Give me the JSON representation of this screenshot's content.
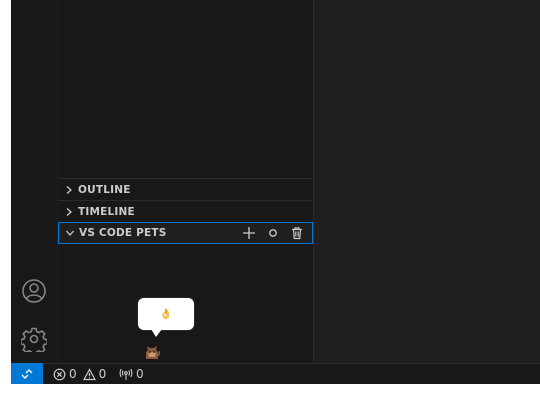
{
  "sidebar": {
    "sections": [
      {
        "title": "OUTLINE",
        "expanded": false
      },
      {
        "title": "TIMELINE",
        "expanded": false
      },
      {
        "title": "VS CODE PETS",
        "expanded": true
      }
    ],
    "pets_actions": [
      "add-pet",
      "throw-ball",
      "remove-pet"
    ]
  },
  "pet": {
    "bubble_emoji": "👌",
    "kind": "cat"
  },
  "activity_bar": {
    "icons": [
      "account-icon",
      "settings-gear-icon"
    ]
  },
  "status_bar": {
    "errors": "0",
    "warnings": "0",
    "ports": "0",
    "remote_color": "#0078d4"
  }
}
